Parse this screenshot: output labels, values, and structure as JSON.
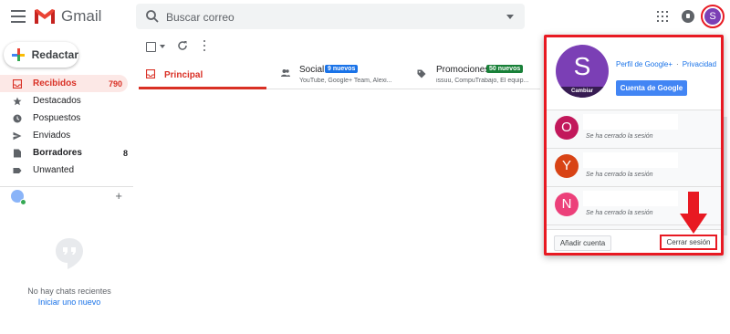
{
  "header": {
    "app_name": "Gmail",
    "search_placeholder": "Buscar correo",
    "avatar_letter": "S"
  },
  "compose_label": "Redactar",
  "nav": [
    {
      "label": "Recibidos",
      "count": "790",
      "active": true,
      "icon": "inbox-icon"
    },
    {
      "label": "Destacados",
      "count": "",
      "icon": "star-icon"
    },
    {
      "label": "Pospuestos",
      "count": "",
      "icon": "clock-icon"
    },
    {
      "label": "Enviados",
      "count": "",
      "icon": "send-icon"
    },
    {
      "label": "Borradores",
      "count": "8",
      "bold": true,
      "icon": "draft-icon"
    },
    {
      "label": "Unwanted",
      "count": "",
      "icon": "label-icon"
    }
  ],
  "chat": {
    "empty_text": "No hay chats recientes",
    "start_link": "Iniciar uno nuevo"
  },
  "tabs": [
    {
      "title": "Principal",
      "active": true,
      "icon": "inbox-icon"
    },
    {
      "title": "Social",
      "badge": "9 nuevos",
      "badge_color": "#1a73e8",
      "sub": "YouTube, Google+ Team, Alexi...",
      "icon": "people-icon"
    },
    {
      "title": "Promociones",
      "badge": "50 nuevos",
      "badge_color": "#188038",
      "sub": "issuu, CompuTrabajo, El equip...",
      "icon": "tag-icon"
    }
  ],
  "account_panel": {
    "avatar_letter": "S",
    "change_label": "Cambiar",
    "profile_link": "Perfil de Google+",
    "privacy_link": "Privacidad",
    "google_account_button": "Cuenta de Google",
    "accounts": [
      {
        "letter": "O",
        "color": "#c2185b",
        "status": "Se ha cerrado la sesión"
      },
      {
        "letter": "Y",
        "color": "#d84315",
        "status": "Se ha cerrado la sesión"
      },
      {
        "letter": "N",
        "color": "#ec407a",
        "status": "Se ha cerrado la sesión"
      }
    ],
    "add_account": "Añadir cuenta",
    "sign_out": "Cerrar sesión"
  },
  "colors": {
    "accent_red": "#d93025",
    "highlight_red": "#e81922",
    "avatar_purple": "#7b3fb5",
    "google_blue": "#4285f4"
  }
}
